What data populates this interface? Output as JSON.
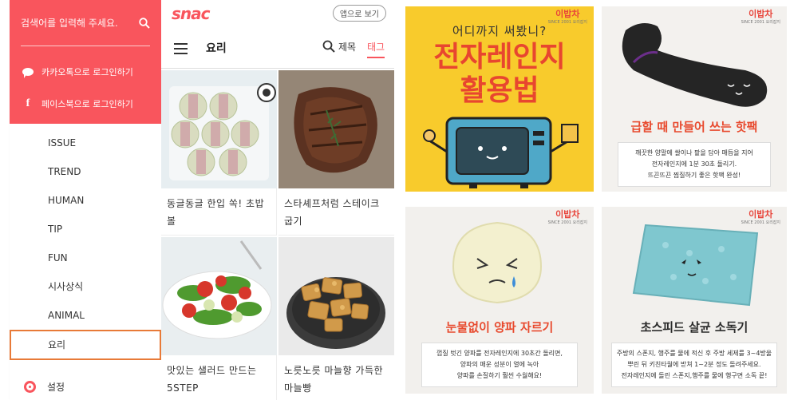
{
  "sidebar": {
    "search_placeholder": "검색어를 입력해 주세요.",
    "kakao_login": "카카오톡으로 로그인하기",
    "facebook_login": "페이스북으로 로그인하기",
    "facebook_glyph": "f",
    "items": [
      {
        "label": "ISSUE"
      },
      {
        "label": "TREND"
      },
      {
        "label": "HUMAN"
      },
      {
        "label": "TIP"
      },
      {
        "label": "FUN"
      },
      {
        "label": "시사상식"
      },
      {
        "label": "ANIMAL"
      },
      {
        "label": "요리",
        "selected": true
      }
    ],
    "settings": "설정",
    "accent": "#f9555d",
    "selected_border": "#e87a38"
  },
  "app": {
    "logo": "snac",
    "app_button": "앱으로 보기",
    "page_title": "요리",
    "search_option_title": "제목",
    "search_option_tag": "태그",
    "cards": [
      {
        "caption": "동글동글 한입 쏙! 초밥볼",
        "icon": "rice-ball-photo"
      },
      {
        "caption": "스타셰프처럼 스테이크 굽기",
        "icon": "steak-photo"
      },
      {
        "caption": "맛있는 샐러드 만드는 5STEP",
        "icon": "salad-photo"
      },
      {
        "caption": "노릇노릇 마늘향 가득한 마늘빵",
        "icon": "garlic-bread-photo"
      }
    ]
  },
  "tiles": {
    "brand": "이밥차",
    "brand_sub": "SINCE 2001 요리잡지",
    "t1": {
      "subtitle": "어디까지 써봤니?",
      "title_line1": "전자레인지",
      "title_line2": "활용법"
    },
    "t2": {
      "title": "급할 때 만들어 쓰는 핫팩",
      "desc_line1": "깨끗한 양말에 쌀이나 팥을 담아 매듭을 지어",
      "desc_line2": "전자레인지에 1분 30초 돌리기.",
      "desc_line3": "뜨끈뜨끈 찜질하기 좋은 핫팩 완성!"
    },
    "t3": {
      "title": "눈물없이 양파 자르기",
      "desc_line1": "껍질 벗긴 양파를 전자레인지에 30초간 돌리면,",
      "desc_line2": "양파의 매운 성분이 열에 녹아",
      "desc_line3": "양파를 손질하기 훨씬 수월해요!"
    },
    "t4": {
      "title": "초스피드 살균 소독기",
      "desc_line1": "주방의 스폰지, 행주를 물에 적신 후 주방 세제를 3~4방울",
      "desc_line2": "뿌린 뒤 키친타월에 받쳐 1~2분 정도 돌려주세요.",
      "desc_line3": "전자레인지에 돌린 스폰지,행주를 물에 행구면 소독 끝!"
    }
  }
}
